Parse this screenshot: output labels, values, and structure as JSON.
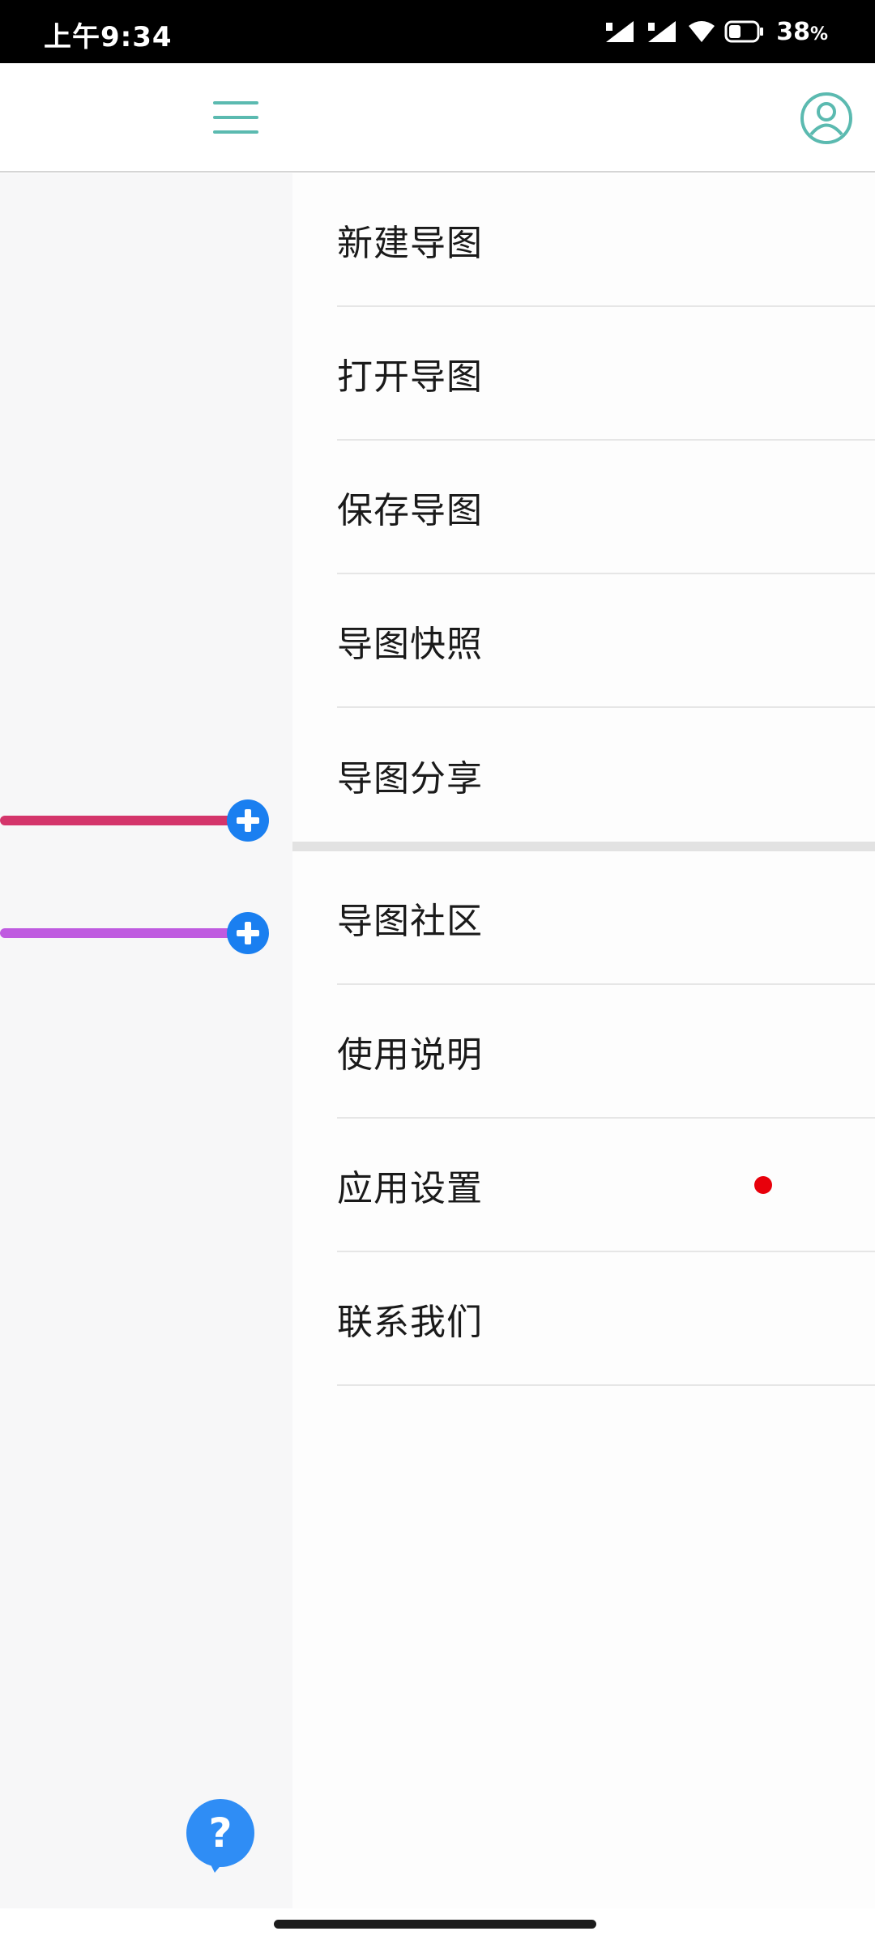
{
  "status_bar": {
    "time": "上午9:34",
    "battery_percent": "38",
    "battery_unit": "%",
    "icons": [
      "signal-1-icon",
      "signal-2-icon",
      "wifi-icon",
      "battery-icon"
    ]
  },
  "header": {
    "menu_icon": "hamburger-menu-icon",
    "profile_icon": "user-profile-icon",
    "accent_color": "#5bbab0"
  },
  "canvas": {
    "branches": [
      {
        "color": "#d4356b",
        "action_icon": "add-node-icon"
      },
      {
        "color": "#bf5be0",
        "action_icon": "add-node-icon"
      }
    ],
    "help_icon": "help-question-icon",
    "help_color": "#2f8df5"
  },
  "drawer": {
    "primary_items": [
      {
        "label": "新建导图"
      },
      {
        "label": "打开导图"
      },
      {
        "label": "保存导图"
      },
      {
        "label": "导图快照"
      },
      {
        "label": "导图分享"
      }
    ],
    "secondary_items": [
      {
        "label": "导图社区"
      },
      {
        "label": "使用说明"
      },
      {
        "label": "应用设置",
        "badge": "red-dot"
      },
      {
        "label": "联系我们"
      }
    ],
    "badge_color": "#e8000b"
  }
}
